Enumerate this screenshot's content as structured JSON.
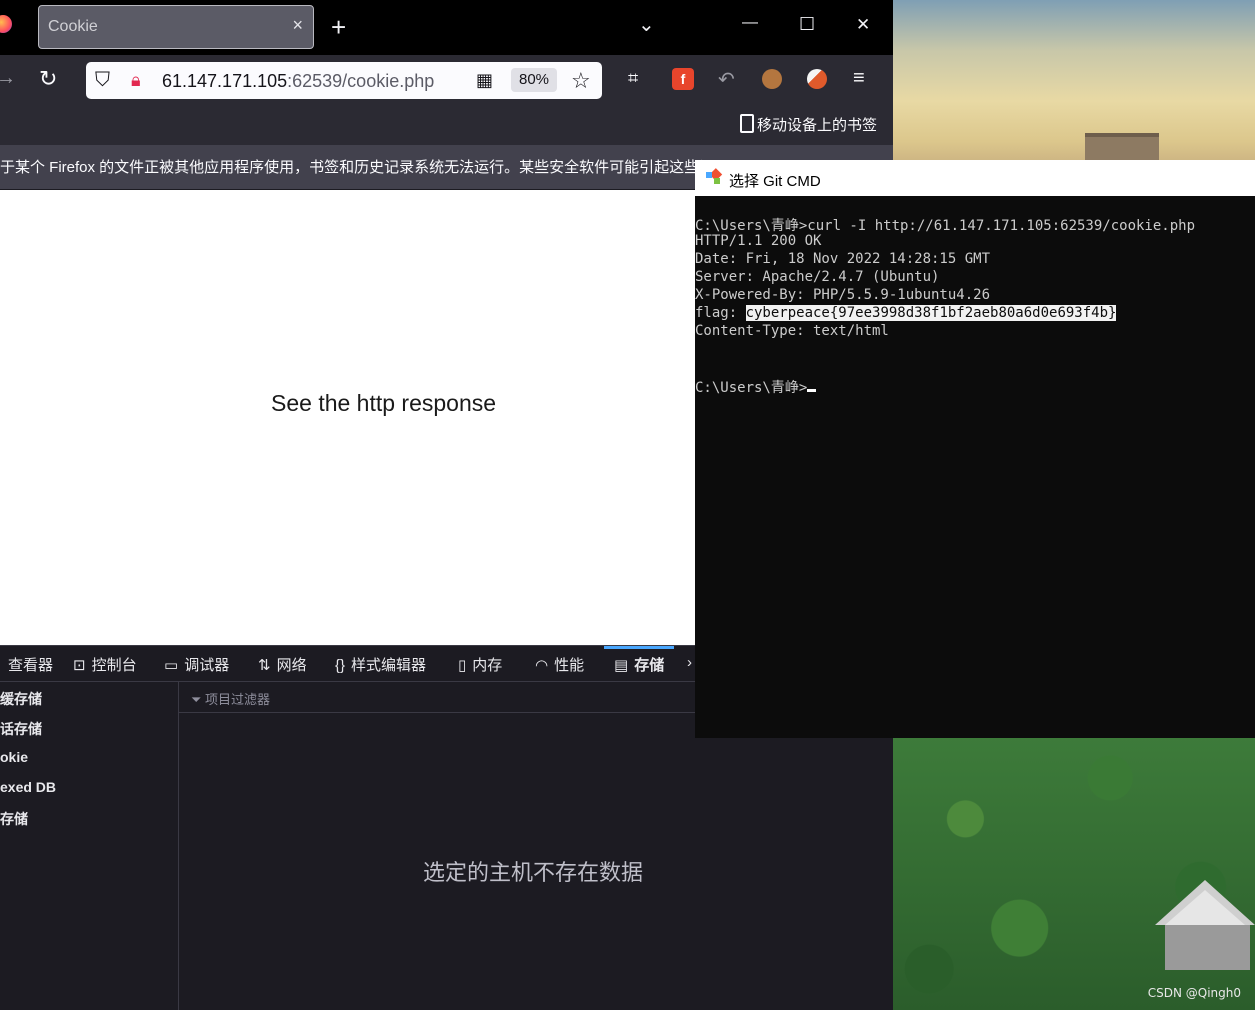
{
  "browser": {
    "tab": {
      "title": "Cookie",
      "close": "×"
    },
    "new_tab": "+",
    "tab_list": "⌄",
    "window": {
      "minimize": "—",
      "maximize": "☐",
      "close": "✕"
    },
    "url": {
      "host": "61.147.171.105",
      "path": ":62539/cookie.php"
    },
    "zoom": "80%",
    "bookmarks": {
      "mobile": "移动设备上的书签"
    },
    "notice": "于某个 Firefox 的文件正被其他应用程序使用，书签和历史记录系统无法运行。某些安全软件可能引起这些问题",
    "page_text": "See the http response"
  },
  "devtools": {
    "tabs": [
      {
        "label": "查看器",
        "icon": "inspector-icon"
      },
      {
        "label": "控制台",
        "icon": "console-icon"
      },
      {
        "label": "调试器",
        "icon": "debugger-icon"
      },
      {
        "label": "网络",
        "icon": "network-icon"
      },
      {
        "label": "样式编辑器",
        "icon": "style-editor-icon"
      },
      {
        "label": "内存",
        "icon": "memory-icon"
      },
      {
        "label": "性能",
        "icon": "performance-icon"
      },
      {
        "label": "存储",
        "icon": "storage-icon",
        "active": true
      }
    ],
    "sidebar": [
      "缓存储",
      "话存储",
      "okie",
      "exed DB",
      "存储"
    ],
    "filter_placeholder": "项目过滤器",
    "empty_message": "选定的主机不存在数据"
  },
  "terminal": {
    "title": "选择 Git CMD",
    "lines": [
      "C:\\Users\\青峥>curl -I http://61.147.171.105:62539/cookie.php",
      "HTTP/1.1 200 OK",
      "Date: Fri, 18 Nov 2022 14:28:15 GMT",
      "Server: Apache/2.4.7 (Ubuntu)",
      "X-Powered-By: PHP/5.5.9-1ubuntu4.26"
    ],
    "flag_label": "flag: ",
    "flag_value": "cyberpeace{97ee3998d38f1bf2aeb80a6d0e693f4b}",
    "content_type": "Content-Type: text/html",
    "prompt": "C:\\Users\\青峥>"
  },
  "watermark": "CSDN @Qingh0"
}
